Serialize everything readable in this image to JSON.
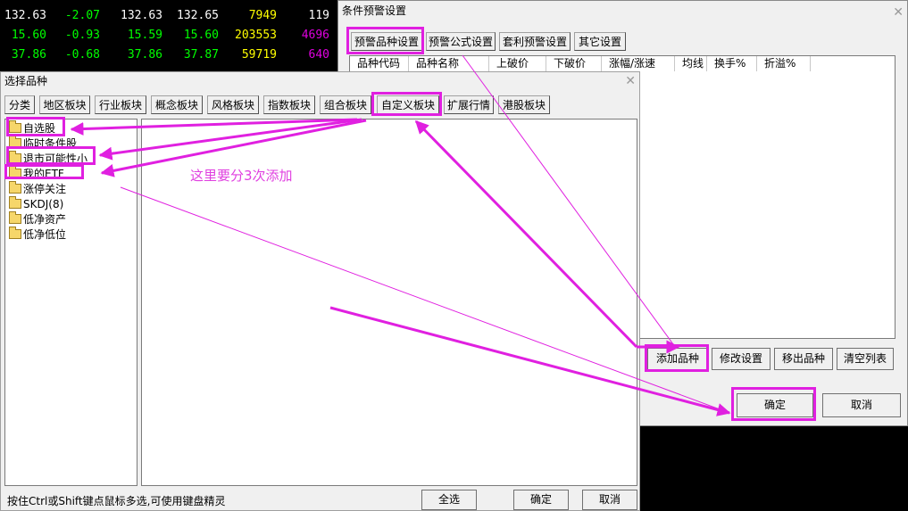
{
  "quotes": {
    "rows": [
      {
        "cells": [
          "132.63",
          "-2.07",
          "132.63",
          "132.65",
          "7949",
          "119"
        ],
        "colors": [
          "#ffffff",
          "#00ff00",
          "#ffffff",
          "#ffffff",
          "#ffff00",
          "#ffffff"
        ]
      },
      {
        "cells": [
          "15.60",
          "-0.93",
          "15.59",
          "15.60",
          "203553",
          "4696"
        ],
        "colors": [
          "#00ff00",
          "#00ff00",
          "#00ff00",
          "#00ff00",
          "#ffff00",
          "#e000e0"
        ]
      },
      {
        "cells": [
          "37.86",
          "-0.68",
          "37.86",
          "37.87",
          "59719",
          "640"
        ],
        "colors": [
          "#00ff00",
          "#00ff00",
          "#00ff00",
          "#00ff00",
          "#ffff00",
          "#e000e0"
        ]
      }
    ]
  },
  "alert_dialog": {
    "title": "条件预警设置",
    "tabs": [
      "预警品种设置",
      "预警公式设置",
      "套利预警设置",
      "其它设置"
    ],
    "columns": [
      "品种代码",
      "品种名称",
      "上破价",
      "下破价",
      "涨幅/涨速",
      "均线",
      "换手%",
      "折溢%"
    ],
    "buttons": {
      "add": "添加品种",
      "modify": "修改设置",
      "remove": "移出品种",
      "clear": "清空列表"
    },
    "ok": "确定",
    "cancel": "取消"
  },
  "select_dialog": {
    "title": "选择品种",
    "tabs": [
      "分类",
      "地区板块",
      "行业板块",
      "概念板块",
      "风格板块",
      "指数板块",
      "组合板块",
      "自定义板块",
      "扩展行情",
      "港股板块"
    ],
    "tree": [
      "自选股",
      "临时条件股",
      "退市可能性小",
      "我的ETF",
      "涨停关注",
      "SKDJ(8)",
      "低净资产",
      "低净低位"
    ],
    "hint": "按住Ctrl或Shift键点鼠标多选,可使用键盘精灵",
    "select_all": "全选",
    "ok": "确定",
    "cancel": "取消"
  },
  "annotation": {
    "note": "这里要分3次添加",
    "color": "#e020e0"
  }
}
